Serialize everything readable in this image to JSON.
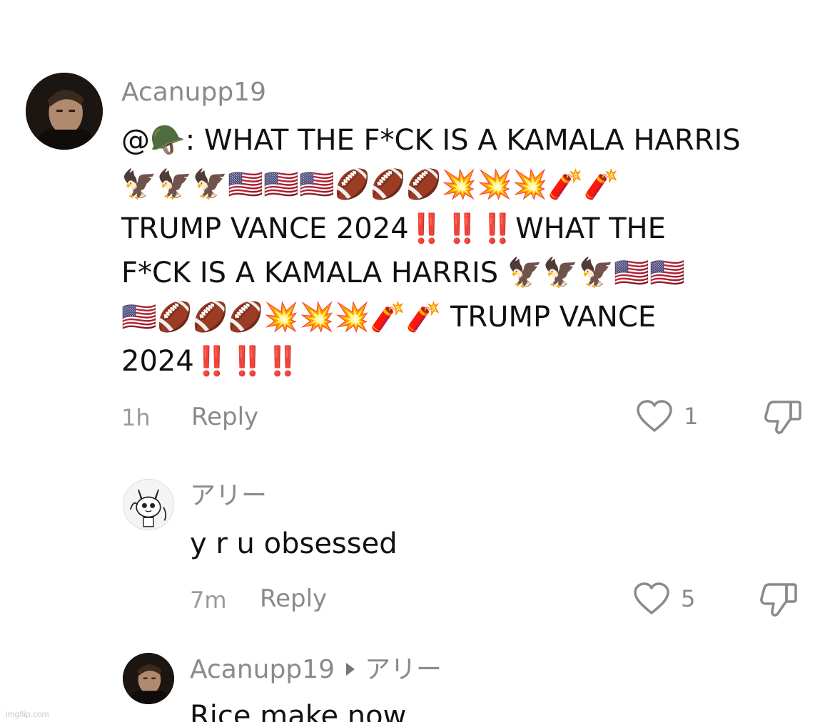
{
  "comments": [
    {
      "username": "Acanupp19",
      "lines": [
        "@🪖: WHAT THE F*CK IS A KAMALA HARRIS",
        "🦅🦅🦅🇺🇸🇺🇸🇺🇸🏈🏈🏈💥💥💥🧨🧨",
        "TRUMP VANCE 2024‼️‼️‼️WHAT THE",
        "F*CK IS A KAMALA HARRIS 🦅🦅🦅🇺🇸🇺🇸",
        "🇺🇸🏈🏈🏈💥💥💥🧨🧨 TRUMP VANCE",
        "2024‼️‼️‼️"
      ],
      "time": "1h",
      "reply_label": "Reply",
      "likes": "1"
    },
    {
      "username": "アリー",
      "text": "y r u obsessed",
      "time": "7m",
      "reply_label": "Reply",
      "likes": "5"
    },
    {
      "username": "Acanupp19",
      "reply_to": "アリー",
      "text": "Rice make now"
    }
  ],
  "watermark": "imgflip.com",
  "icons": {
    "like": "heart-outline-icon",
    "dislike": "thumbs-down-outline-icon"
  },
  "colors": {
    "username": "#8a8a8a",
    "meta": "#9a9a9a",
    "text": "#111111"
  }
}
